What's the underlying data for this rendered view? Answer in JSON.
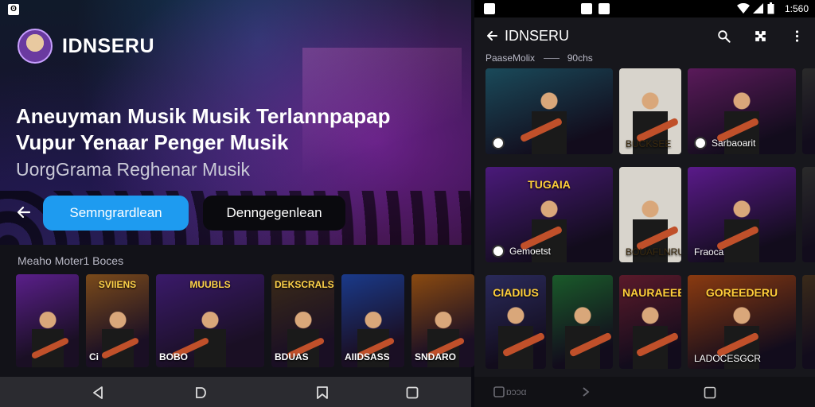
{
  "left": {
    "status_icon": "ʘ",
    "app_title": "IDNSERU",
    "icons": [
      "search-icon",
      "puzzle-icon",
      "more-vert-icon"
    ],
    "headline_line1": "Aneuyman Musik Musik Terlannpapap",
    "headline_line2": "Vupur Yenaar Penger Musik",
    "subline": "UorgGrama Reghenar Musik",
    "primary_button": "Semngrardlean",
    "secondary_button": "Denngegenlean",
    "section_title": "Meaho Moter1 Boces",
    "cards": [
      {
        "top": "",
        "caption": "",
        "bg": "#5a1f8a"
      },
      {
        "top": "SVIIENS",
        "caption": "Ci",
        "bg": "#7a4a1a"
      },
      {
        "top": "MUUBLS",
        "caption": "BOBO",
        "bg": "#3a1a6a"
      },
      {
        "top": "DEKSCRALS",
        "caption": "BDUAS",
        "bg": "#3a2a18"
      },
      {
        "top": "",
        "caption": "AIIDSASS",
        "bg": "#1a3a8a"
      },
      {
        "top": "",
        "caption": "SNDARO",
        "bg": "#8a4a10"
      }
    ]
  },
  "right": {
    "status_time": "1:560",
    "app_title": "IDNSERU",
    "section_title": "PaaseMolix",
    "section_title_tail": "90chs",
    "cards": [
      {
        "top": "",
        "caption": "",
        "bg": "#1a4a5a",
        "has_dot": true
      },
      {
        "top": "",
        "caption": "BUCKSEE",
        "bg": "#d8d4cc",
        "has_dot": false
      },
      {
        "top": "",
        "caption": "Sarbaoarit",
        "bg": "#5a1a5a",
        "has_dot": true
      },
      {
        "top": "",
        "caption": "",
        "bg": "#2a2a2a",
        "has_dot": false
      },
      {
        "top": "TUGAIA",
        "caption": "Gemoetst",
        "bg": "#4a1a7a",
        "has_dot": true
      },
      {
        "top": "",
        "caption": "BOUAFLNRU",
        "bg": "#d8d4cc",
        "has_dot": false
      },
      {
        "top": "",
        "caption": "Fraoca",
        "bg": "#5a1a8a",
        "has_dot": false
      },
      {
        "top": "",
        "caption": "",
        "bg": "#2a2a2a",
        "has_dot": false
      },
      {
        "top": "CIADIUS",
        "caption": "",
        "bg": "#2a2a5a",
        "has_dot": false
      },
      {
        "top": "",
        "caption": "",
        "bg": "#1a5a2a",
        "has_dot": false
      },
      {
        "top": "NAURAEEE",
        "caption": "",
        "bg": "#5a1a2a",
        "has_dot": false
      },
      {
        "top": "GOREEDERU",
        "caption": "LADOCESGCR",
        "bg": "#8a3a10",
        "has_dot": false
      },
      {
        "top": "",
        "caption": "",
        "bg": "#3a2a1a",
        "has_dot": false
      }
    ],
    "nav_text": "ɒɔɔα"
  }
}
